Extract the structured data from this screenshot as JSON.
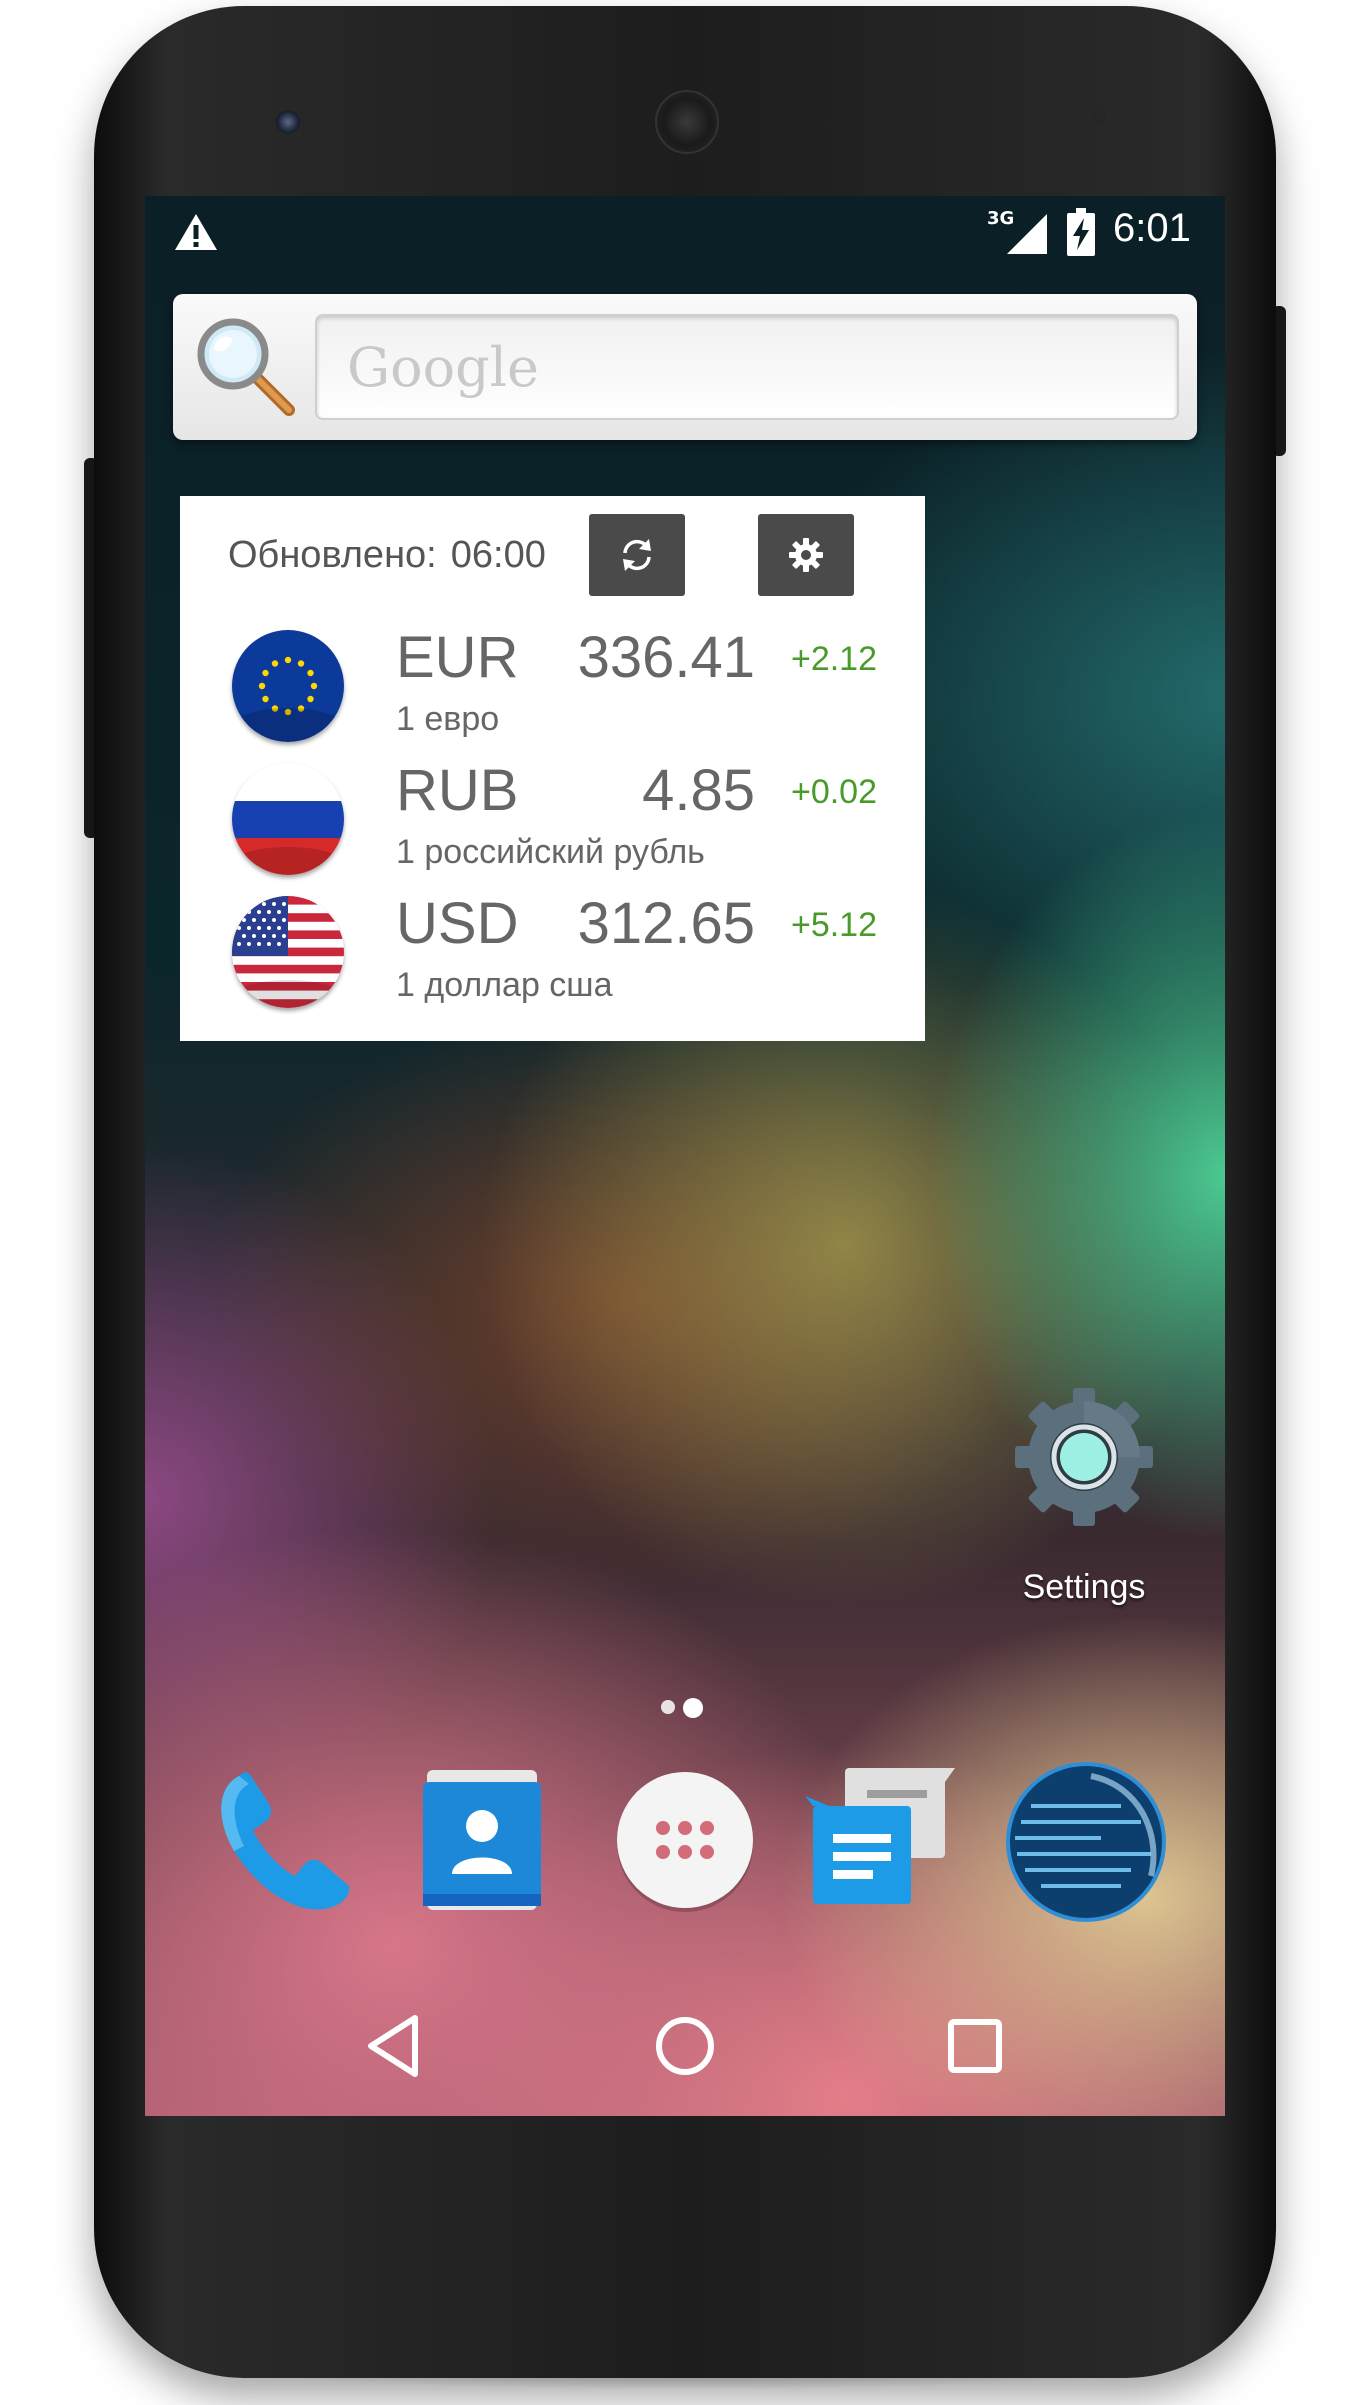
{
  "status_bar": {
    "network": "3G",
    "time": "6:01",
    "icons": [
      "warning-icon",
      "signal-icon",
      "battery-charging-icon"
    ]
  },
  "search": {
    "placeholder": "Google",
    "icon": "magnifier-icon"
  },
  "widget": {
    "updated_label": "Обновлено:",
    "updated_time": "06:00",
    "buttons": [
      "refresh-icon",
      "gear-icon"
    ],
    "rows": [
      {
        "code": "EUR",
        "rate": "336.41",
        "change": "+2.12",
        "desc": "1 евро",
        "flag": "eu-flag-icon"
      },
      {
        "code": "RUB",
        "rate": "4.85",
        "change": "+0.02",
        "desc": "1 российский рубль",
        "flag": "russia-flag-icon"
      },
      {
        "code": "USD",
        "rate": "312.65",
        "change": "+5.12",
        "desc": "1 доллар сша",
        "flag": "usa-flag-icon"
      }
    ],
    "change_color": "#4a9a2a"
  },
  "home": {
    "settings_label": "Settings",
    "dock": [
      "phone-icon",
      "contacts-icon",
      "app-drawer-icon",
      "messaging-icon",
      "browser-globe-icon"
    ]
  },
  "nav": [
    "back-icon",
    "home-icon",
    "recents-icon"
  ]
}
